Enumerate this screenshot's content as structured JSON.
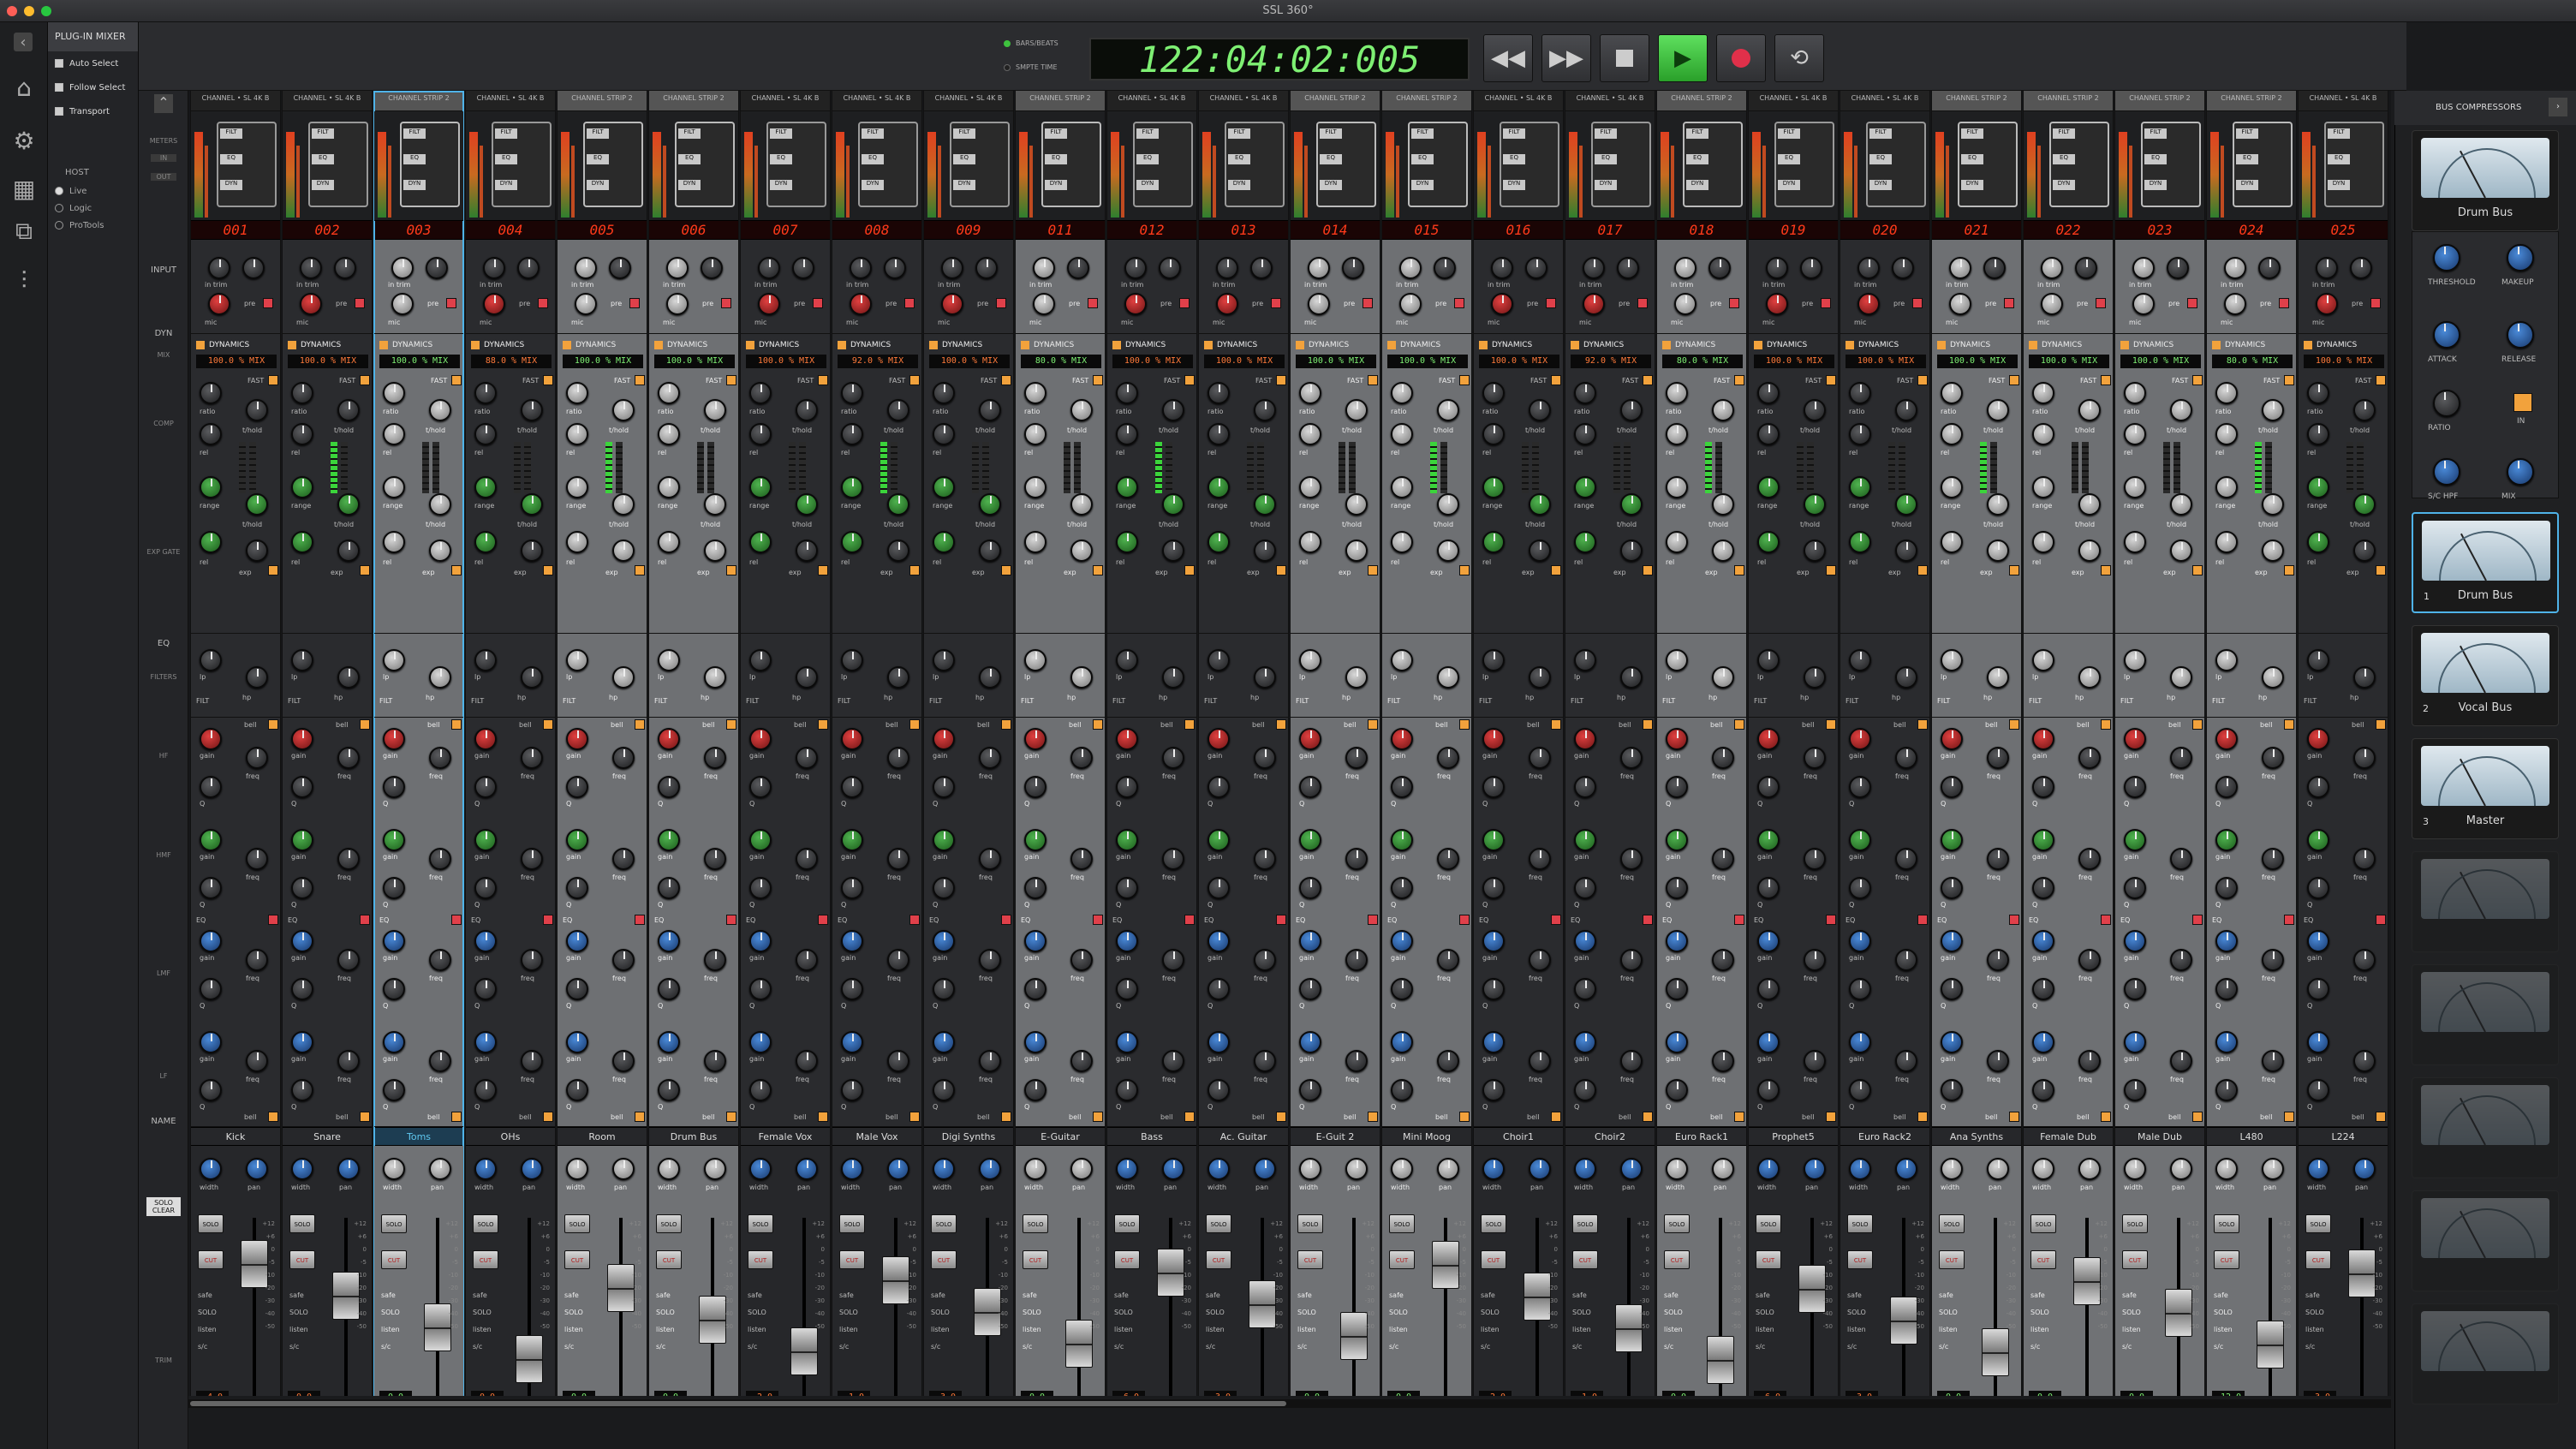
{
  "window": {
    "title": "SSL 360°"
  },
  "sidebar": {
    "panel_title": "PLUG-IN MIXER",
    "options": [
      {
        "label": "Auto Select"
      },
      {
        "label": "Follow Select"
      },
      {
        "label": "Transport"
      }
    ],
    "host_title": "HOST",
    "hosts": [
      {
        "label": "Live",
        "selected": true
      },
      {
        "label": "Logic",
        "selected": false
      },
      {
        "label": "ProTools",
        "selected": false
      }
    ]
  },
  "transport": {
    "timecode": "122:04:02:005",
    "mode_bars": "BARS/BEATS",
    "mode_smpte": "SMPTE TIME",
    "buttons": [
      "rewind",
      "fast-forward",
      "stop",
      "play",
      "record",
      "loop"
    ]
  },
  "row_labels": {
    "meters": "METERS",
    "in": "IN",
    "out": "OUT",
    "input": "INPUT",
    "dyn": "DYN",
    "mix": "MIX",
    "comp": "COMP",
    "exp_gate": "EXP GATE",
    "eq": "EQ",
    "filters": "FILTERS",
    "hf": "HF",
    "hmf": "HMF",
    "lmf": "LMF",
    "lf": "LF",
    "name": "NAME",
    "solo_clear": "SOLO CLEAR",
    "trim": "TRIM"
  },
  "channels": [
    {
      "num": "001",
      "header": "CHANNEL • SL 4K B",
      "name": "Kick",
      "mix": "100.0 % MIX",
      "trim": "-4.0",
      "type": "dark"
    },
    {
      "num": "002",
      "header": "CHANNEL • SL 4K B",
      "name": "Snare",
      "mix": "100.0 % MIX",
      "trim": "0.0",
      "type": "dark"
    },
    {
      "num": "003",
      "header": "CHANNEL STRIP 2",
      "name": "Toms",
      "mix": "100.0 % MIX",
      "trim": "0.0",
      "type": "grey",
      "selected": true
    },
    {
      "num": "004",
      "header": "CHANNEL • SL 4K B",
      "name": "OHs",
      "mix": "88.0 % MIX",
      "trim": "0.0",
      "type": "dark"
    },
    {
      "num": "005",
      "header": "CHANNEL STRIP 2",
      "name": "Room",
      "mix": "100.0 % MIX",
      "trim": "0.0",
      "type": "grey"
    },
    {
      "num": "006",
      "header": "CHANNEL STRIP 2",
      "name": "Drum Bus",
      "mix": "100.0 % MIX",
      "trim": "0.0",
      "type": "grey"
    },
    {
      "num": "007",
      "header": "CHANNEL • SL 4K B",
      "name": "Female Vox",
      "mix": "100.0 % MIX",
      "trim": "-2.0",
      "type": "dark"
    },
    {
      "num": "008",
      "header": "CHANNEL • SL 4K B",
      "name": "Male Vox",
      "mix": "92.0 % MIX",
      "trim": "-1.0",
      "type": "dark"
    },
    {
      "num": "009",
      "header": "CHANNEL • SL 4K B",
      "name": "Digi Synths",
      "mix": "100.0 % MIX",
      "trim": "-3.0",
      "type": "dark"
    },
    {
      "num": "011",
      "header": "CHANNEL STRIP 2",
      "name": "E-Guitar",
      "mix": "80.0 % MIX",
      "trim": "0.0",
      "type": "grey"
    },
    {
      "num": "012",
      "header": "CHANNEL • SL 4K B",
      "name": "Bass",
      "mix": "100.0 % MIX",
      "trim": "-6.0",
      "type": "dark"
    },
    {
      "num": "013",
      "header": "CHANNEL • SL 4K B",
      "name": "Ac. Guitar",
      "mix": "100.0 % MIX",
      "trim": "-3.0",
      "type": "dark"
    },
    {
      "num": "014",
      "header": "CHANNEL STRIP 2",
      "name": "E-Guit 2",
      "mix": "100.0 % MIX",
      "trim": "0.0",
      "type": "grey"
    },
    {
      "num": "015",
      "header": "CHANNEL STRIP 2",
      "name": "Mini Moog",
      "mix": "100.0 % MIX",
      "trim": "0.0",
      "type": "grey"
    },
    {
      "num": "016",
      "header": "CHANNEL • SL 4K B",
      "name": "Choir1",
      "mix": "100.0 % MIX",
      "trim": "-2.0",
      "type": "dark"
    },
    {
      "num": "017",
      "header": "CHANNEL • SL 4K B",
      "name": "Choir2",
      "mix": "92.0 % MIX",
      "trim": "-1.0",
      "type": "dark"
    },
    {
      "num": "018",
      "header": "CHANNEL STRIP 2",
      "name": "Euro Rack1",
      "mix": "80.0 % MIX",
      "trim": "0.0",
      "type": "grey"
    },
    {
      "num": "019",
      "header": "CHANNEL • SL 4K B",
      "name": "Prophet5",
      "mix": "100.0 % MIX",
      "trim": "-6.0",
      "type": "dark"
    },
    {
      "num": "020",
      "header": "CHANNEL • SL 4K B",
      "name": "Euro Rack2",
      "mix": "100.0 % MIX",
      "trim": "-3.0",
      "type": "dark"
    },
    {
      "num": "021",
      "header": "CHANNEL STRIP 2",
      "name": "Ana Synths",
      "mix": "100.0 % MIX",
      "trim": "0.0",
      "type": "grey"
    },
    {
      "num": "022",
      "header": "CHANNEL STRIP 2",
      "name": "Female Dub",
      "mix": "100.0 % MIX",
      "trim": "0.0",
      "type": "grey"
    },
    {
      "num": "023",
      "header": "CHANNEL STRIP 2",
      "name": "Male Dub",
      "mix": "100.0 % MIX",
      "trim": "0.0",
      "type": "grey"
    },
    {
      "num": "024",
      "header": "CHANNEL STRIP 2",
      "name": "L480",
      "mix": "80.0 % MIX",
      "trim": "-12.0",
      "type": "grey"
    },
    {
      "num": "025",
      "header": "CHANNEL • SL 4K B",
      "name": "L224",
      "mix": "100.0 % MIX",
      "trim": "-3.0",
      "type": "dark"
    }
  ],
  "knob_labels": {
    "in_trim": "in trim",
    "pre": "pre",
    "mic": "mic",
    "dynamics": "DYNAMICS",
    "ratio": "ratio",
    "thold": "t/hold",
    "rel": "rel",
    "range": "range",
    "exp": "exp",
    "fast": "FAST",
    "pk": "PK",
    "lp": "lp",
    "hp": "hp",
    "filt": "FILT",
    "bell": "bell",
    "gain": "gain",
    "freq": "freq",
    "q": "Q",
    "eq": "EQ",
    "pan": "pan",
    "width": "width",
    "solo": "SOLO",
    "cut": "CUT",
    "safe": "safe",
    "listen": "listen",
    "sc": "s/c",
    "out_trim": "out trim"
  },
  "fader_scale": [
    "+12",
    "+6",
    "0",
    "-5",
    "-10",
    "-20",
    "-30",
    "-40",
    "-50"
  ],
  "bus_compressors": {
    "title": "BUS COMPRESSORS",
    "top_label": "Drum Bus",
    "controls": [
      "THRESHOLD",
      "MAKEUP",
      "ATTACK",
      "RELEASE",
      "RATIO",
      "IN",
      "S/C HPF",
      "MIX"
    ],
    "buses": [
      {
        "index": "1",
        "label": "Drum Bus",
        "active": true,
        "selected": true
      },
      {
        "index": "2",
        "label": "Vocal Bus",
        "active": true
      },
      {
        "index": "3",
        "label": "Master",
        "active": true
      },
      {
        "index": "",
        "label": "",
        "active": false
      },
      {
        "index": "",
        "label": "",
        "active": false
      },
      {
        "index": "",
        "label": "",
        "active": false
      },
      {
        "index": "",
        "label": "",
        "active": false
      },
      {
        "index": "",
        "label": "",
        "active": false
      }
    ]
  },
  "colors": {
    "accent": "#4fb3e8",
    "play": "#3ec23e",
    "record": "#e0304a",
    "timecode": "#7ef073",
    "display_red": "#ff3a1a"
  }
}
